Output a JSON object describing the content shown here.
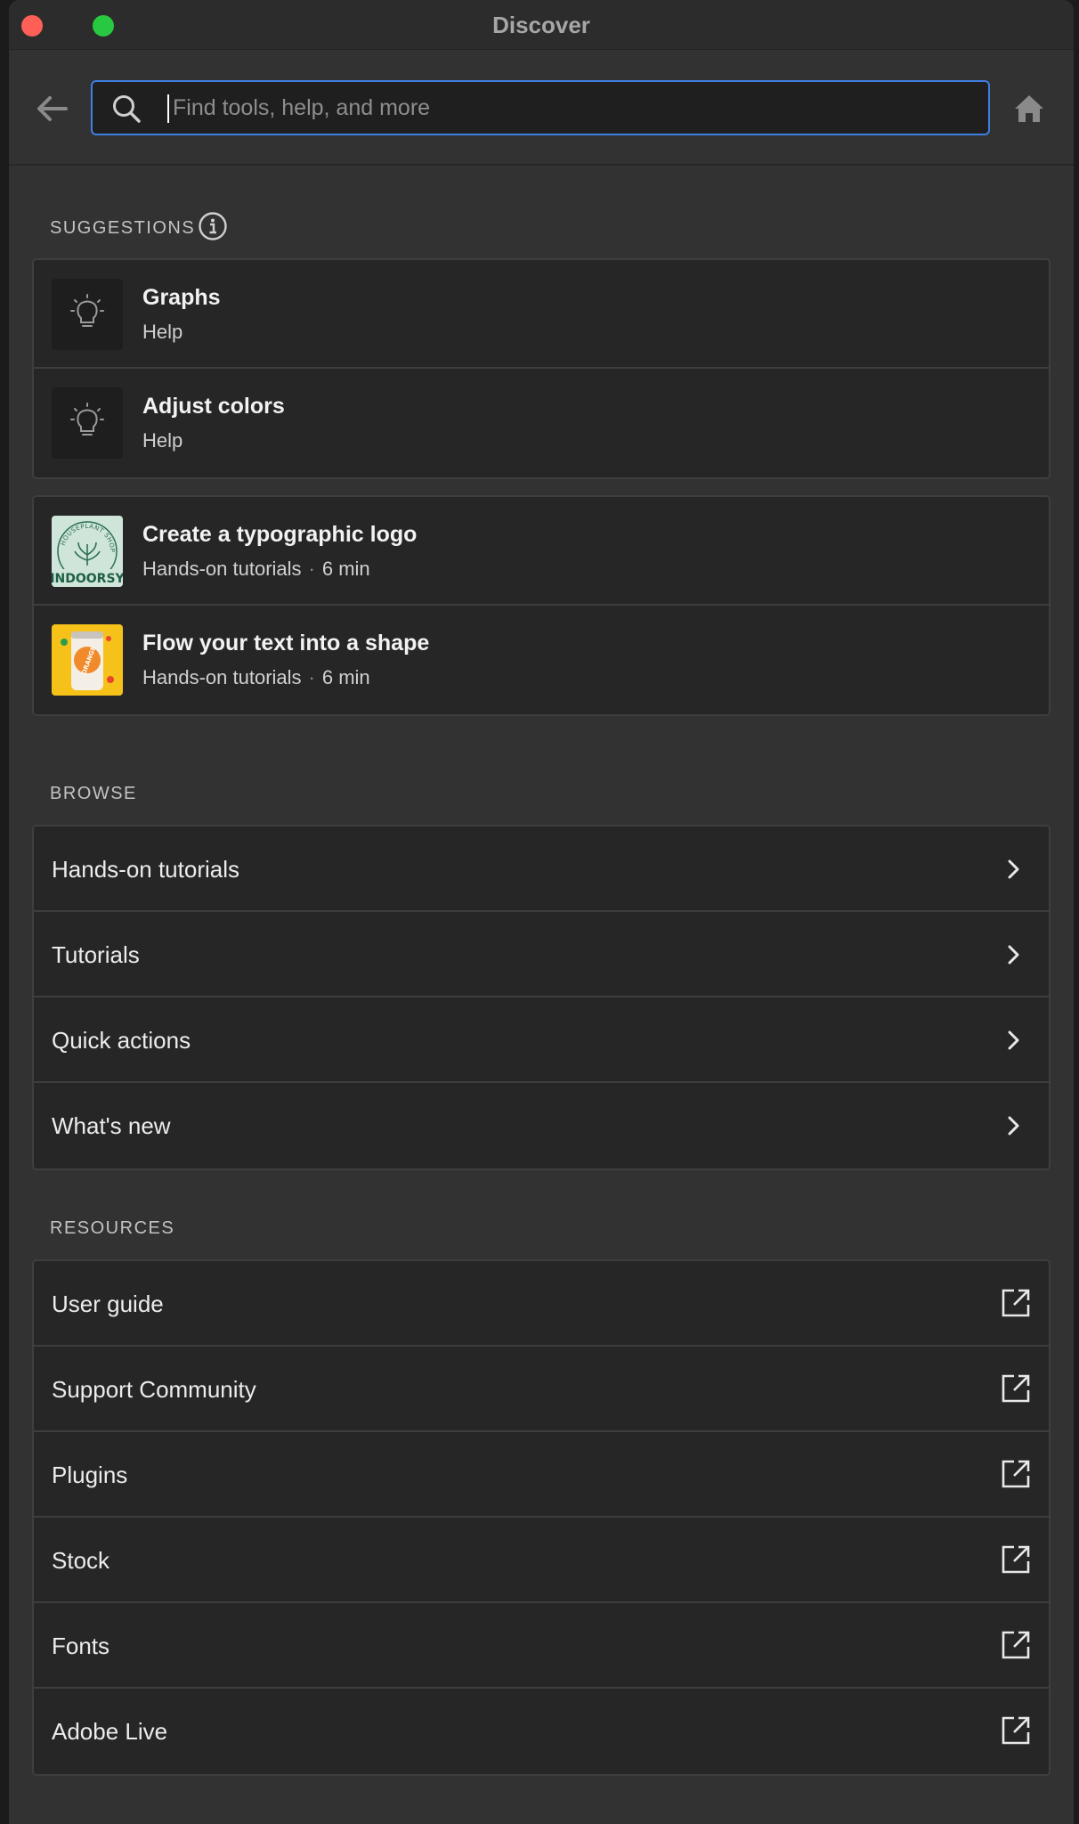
{
  "window": {
    "title": "Discover"
  },
  "search": {
    "placeholder": "Find tools, help, and more",
    "value": ""
  },
  "suggestions": {
    "label": "SUGGESTIONS",
    "help_items": [
      {
        "title": "Graphs",
        "subtitle": "Help",
        "icon": "lightbulb-icon"
      },
      {
        "title": "Adjust colors",
        "subtitle": "Help",
        "icon": "lightbulb-icon"
      }
    ],
    "tutorial_items": [
      {
        "title": "Create a typographic logo",
        "category": "Hands-on tutorials",
        "duration": "6 min",
        "thumb_text": "INDOORSY",
        "thumb_arc": "HOUSEPLANT SHOP"
      },
      {
        "title": "Flow your text into a shape",
        "category": "Hands-on tutorials",
        "duration": "6 min",
        "thumb_text": "ORANGE"
      }
    ],
    "separator": "·"
  },
  "browse": {
    "label": "BROWSE",
    "items": [
      {
        "label": "Hands-on tutorials"
      },
      {
        "label": "Tutorials"
      },
      {
        "label": "Quick actions"
      },
      {
        "label": "What's new"
      }
    ]
  },
  "resources": {
    "label": "RESOURCES",
    "items": [
      {
        "label": "User guide"
      },
      {
        "label": "Support Community"
      },
      {
        "label": "Plugins"
      },
      {
        "label": "Stock"
      },
      {
        "label": "Fonts"
      },
      {
        "label": "Adobe Live"
      }
    ]
  },
  "colors": {
    "accent": "#3f7ee0",
    "window_bg": "#323232",
    "card_bg": "#262626",
    "close": "#fe5f57",
    "zoom": "#28c840"
  }
}
